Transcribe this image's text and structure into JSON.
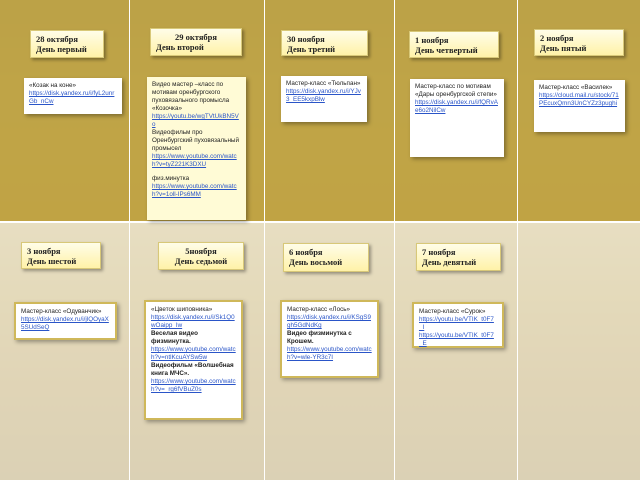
{
  "days": [
    {
      "date": "28 октября",
      "label": "День первый",
      "items": [
        {
          "t": "«Козак на коне»",
          "k": "text"
        },
        {
          "t": "https://disk.yandex.ru/i/fyL2unrGb_nCw",
          "k": "link"
        }
      ]
    },
    {
      "date": "29 октября",
      "label": "День второй",
      "items": [
        {
          "t": "Видео мастер –класс по мотивам оренбургского пуховязального промысла «Козочка»",
          "k": "text"
        },
        {
          "t": "https://youtu.be/wgTVtUkBN5Vo",
          "k": "link"
        },
        {
          "t": "Видеофильм про Оренбургский пуховязальный промысел",
          "k": "text"
        },
        {
          "t": "https://www.youtube.com/watch?v=tyZ221K3DXU",
          "k": "link"
        },
        {
          "t": "физ.минутка",
          "k": "text"
        },
        {
          "t": "https://www.youtube.com/watch?v=1oll-IPs6MM",
          "k": "link"
        }
      ]
    },
    {
      "date": "30 ноября",
      "label": "День третий",
      "items": [
        {
          "t": "Мастер-класс «Тюльпан»",
          "k": "text"
        },
        {
          "t": "https://disk.yandex.ru/i/YJv3_EE5kxpBlw",
          "k": "link"
        }
      ]
    },
    {
      "date": "1 ноября",
      "label": "День четвертый",
      "items": [
        {
          "t": "Мастер-класс по мотивам «Дары оренбургской степи»",
          "k": "text"
        },
        {
          "t": "https://disk.yandex.ru/i/fQRvAe6o2NilCw",
          "k": "link"
        }
      ]
    },
    {
      "date": "2 ноября",
      "label": "День пятый",
      "items": [
        {
          "t": "Мастер-класс «Василек»",
          "k": "text"
        },
        {
          "t": "https://cloud.mail.ru/stock/71PEcuxQmn3UnCYZz3pughi",
          "k": "link"
        }
      ]
    },
    {
      "date": "3 ноября",
      "label": "День шестой",
      "items": [
        {
          "t": "Мастер-класс «Одуванчик»",
          "k": "text"
        },
        {
          "t": "https://disk.yandex.ru/i/jlQOyaX5SUdSeQ",
          "k": "link"
        }
      ]
    },
    {
      "date": "5ноября",
      "label": "День седьмой",
      "items": [
        {
          "t": "«Цветок шиповника»",
          "k": "text"
        },
        {
          "t": "https://disk.yandex.ru/i/Sk1Q0wOaipp_Iw",
          "k": "link"
        },
        {
          "t": "Веселая видео физминутка.",
          "k": "bold"
        },
        {
          "t": "https://www.youtube.com/watch?v=ntlKcuAYSw5w",
          "k": "link"
        },
        {
          "t": "Видеофильм «Волшебная книга МЧС».",
          "k": "bold"
        },
        {
          "t": "https://www.youtube.com/watch?v=_rg6fVBuZ0s",
          "k": "link"
        }
      ]
    },
    {
      "date": "6 ноября",
      "label": "День восьмой",
      "items": [
        {
          "t": "Мастер-класс «Лось»",
          "k": "text"
        },
        {
          "t": "https://disk.yandex.ru/i/KSgS9gh5GdNdKg",
          "k": "link"
        },
        {
          "t": "Видео физминутка с Крошем.",
          "k": "text"
        },
        {
          "t": "https://www.youtube.com/watch?v=wle-YR3c7I",
          "k": "link"
        }
      ]
    },
    {
      "date": "7 ноября",
      "label": "День девятый",
      "items": [
        {
          "t": "Мастер-класс «Сурок»",
          "k": "text"
        },
        {
          "t": "https://youtu.be/VTIK_t0F7_I",
          "k": "link"
        },
        {
          "t": "https://youtu.be/VTIK_t0F7_E",
          "k": "link"
        }
      ]
    }
  ]
}
